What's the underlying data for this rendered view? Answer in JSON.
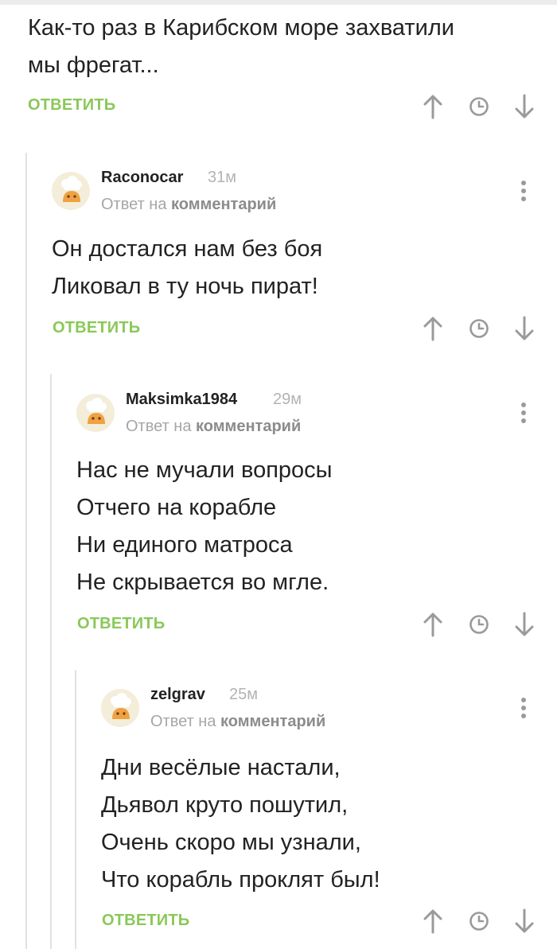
{
  "root": {
    "text": "Как-то раз в Карибском море захватили\nмы фрегат...",
    "reply_label": "ОТВЕТИТЬ"
  },
  "comments": [
    {
      "author": "Raconocar",
      "time": "31м",
      "reply_to_prefix": "Ответ на",
      "reply_to_link": "комментарий",
      "text": "Он достался нам без боя\nЛиковал в ту ночь пират!",
      "reply_label": "ОТВЕТИТЬ"
    },
    {
      "author": "Maksimka1984",
      "time": "29м",
      "reply_to_prefix": "Ответ на",
      "reply_to_link": "комментарий",
      "text": "Нас не мучали вопросы\nОтчего на корабле\nНи единого матроса\nНе скрывается во мгле.",
      "reply_label": "ОТВЕТИТЬ"
    },
    {
      "author": "zelgrav",
      "time": "25м",
      "reply_to_prefix": "Ответ на",
      "reply_to_link": "комментарий",
      "text": "Дни весёлые настали,\nДьявол круто пошутил,\nОчень скоро мы узнали,\nЧто корабль проклят был!",
      "reply_label": "ОТВЕТИТЬ"
    }
  ],
  "icons": {
    "upvote": "arrow-up-icon",
    "history": "clock-icon",
    "downvote": "arrow-down-icon",
    "more": "more-vertical-icon",
    "avatar": "chef-hat-avatar"
  },
  "colors": {
    "accent_green": "#8ac858",
    "icon_gray": "#9a9a9a",
    "thread_line": "#e2e2e2"
  }
}
